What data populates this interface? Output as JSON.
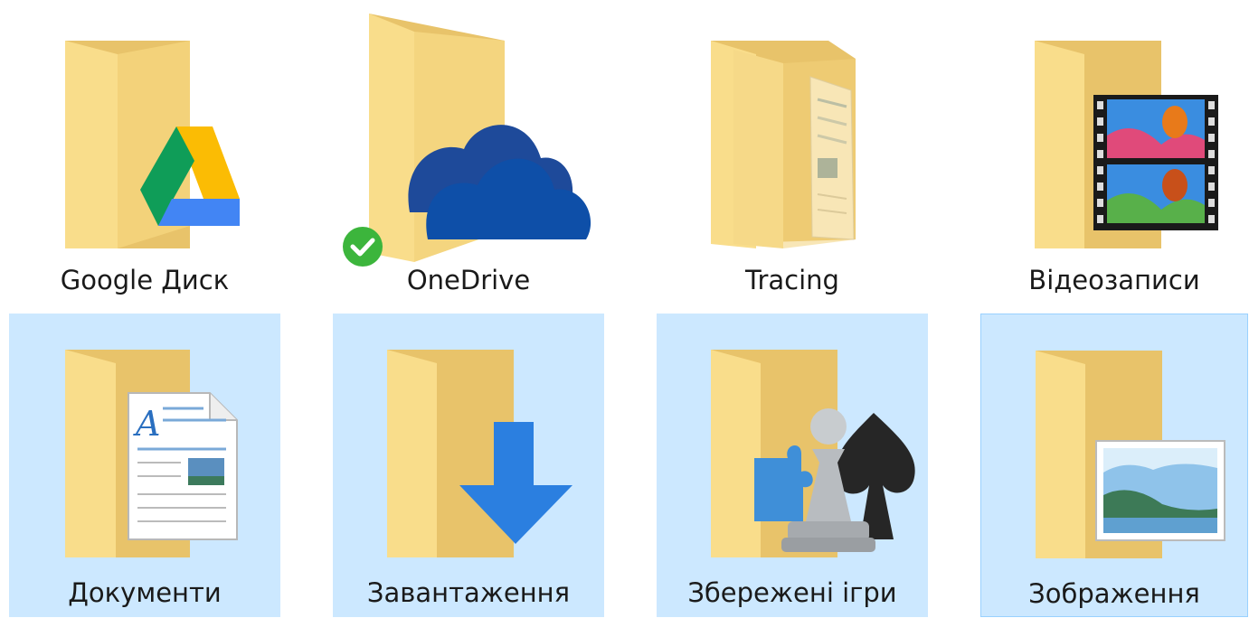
{
  "folders": [
    {
      "label": "Google Диск",
      "icon": "google-drive-folder-icon",
      "selected": false
    },
    {
      "label": "OneDrive",
      "icon": "onedrive-folder-icon",
      "selected": false,
      "status": "synced"
    },
    {
      "label": "Tracing",
      "icon": "document-folder-icon",
      "selected": false
    },
    {
      "label": "Відеозаписи",
      "icon": "videos-folder-icon",
      "selected": false
    },
    {
      "label": "Документи",
      "icon": "documents-folder-icon",
      "selected": true
    },
    {
      "label": "Завантаження",
      "icon": "downloads-folder-icon",
      "selected": true
    },
    {
      "label": "Збережені ігри",
      "icon": "saved-games-folder-icon",
      "selected": true
    },
    {
      "label": "Зображення",
      "icon": "pictures-folder-icon",
      "selected": true,
      "focused": true
    }
  ],
  "colors": {
    "selection": "#cce8ff",
    "focus_border": "#99d1ff",
    "folder_back": "#e8c36a",
    "folder_front": "#f9dd8b",
    "onedrive_blue": "#0e4fa8",
    "check_green": "#3cb53c",
    "download_blue": "#2b7fe0"
  }
}
